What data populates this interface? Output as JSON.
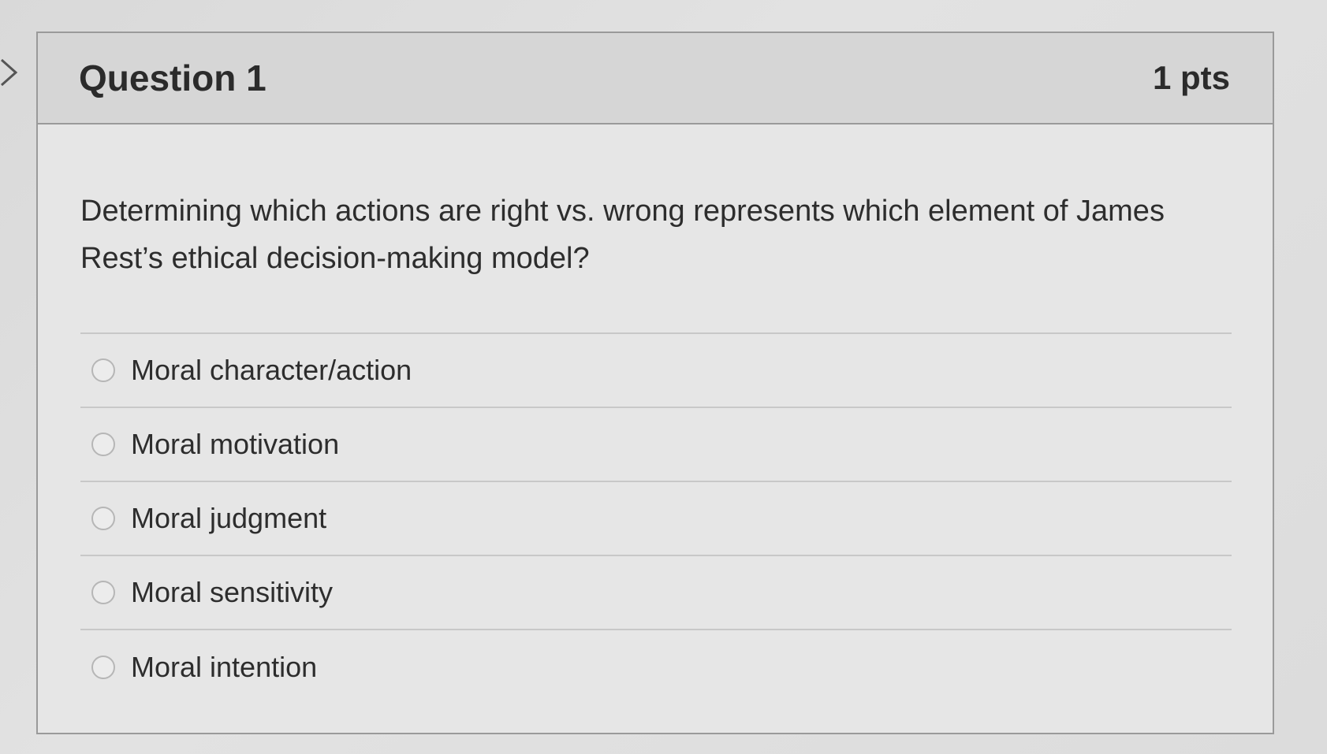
{
  "question": {
    "title": "Question 1",
    "points": "1 pts",
    "text": "Determining which actions are right vs. wrong represents which element of James Rest’s ethical decision-making model?"
  },
  "answers": [
    {
      "label": "Moral character/action",
      "selected": false
    },
    {
      "label": "Moral motivation",
      "selected": false
    },
    {
      "label": "Moral judgment",
      "selected": false
    },
    {
      "label": "Moral sensitivity",
      "selected": false
    },
    {
      "label": "Moral intention",
      "selected": false
    }
  ],
  "icons": {
    "nav": "chevron-right-icon",
    "option": "radio-button-icon"
  },
  "colors": {
    "header_bg": "#d6d6d6",
    "card_bg": "#e6e6e6",
    "border": "#9a9a9a",
    "text": "#2d2d2d"
  }
}
